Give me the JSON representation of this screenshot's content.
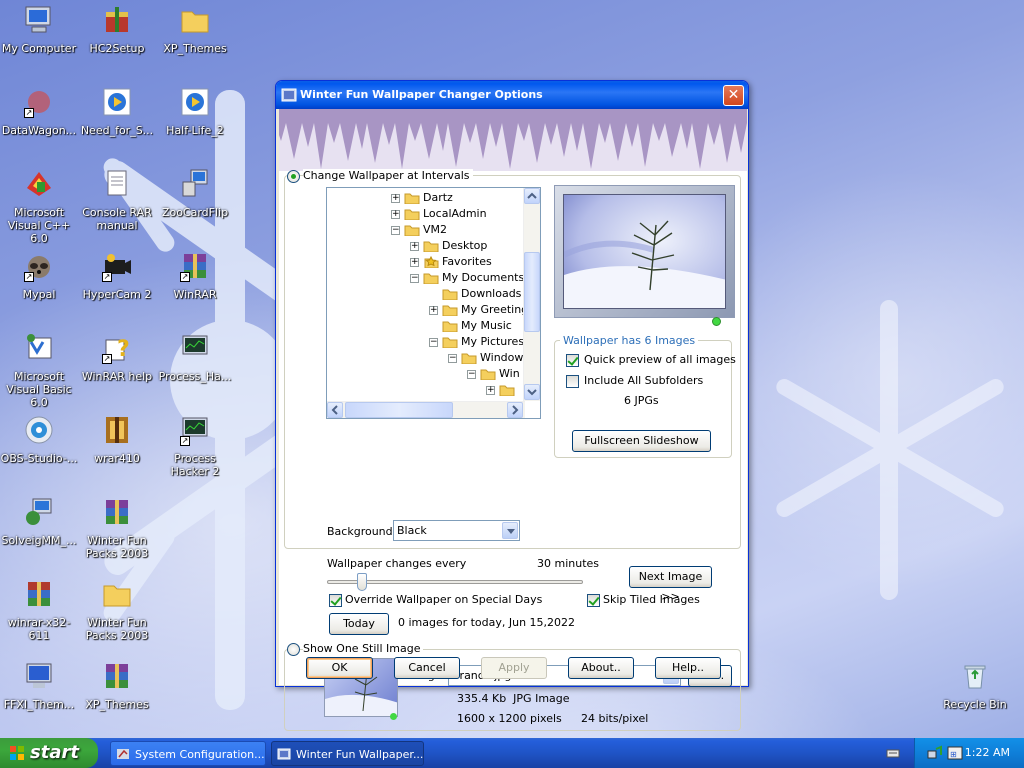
{
  "desktop": {
    "icons": [
      {
        "name": "my-computer",
        "label": "My Computer"
      },
      {
        "name": "hc2setup",
        "label": "HC2Setup"
      },
      {
        "name": "xp-themes-folder",
        "label": "XP_Themes"
      },
      {
        "name": "datawagon",
        "label": "DataWagon..."
      },
      {
        "name": "need-for-speed",
        "label": "Need_for_S..."
      },
      {
        "name": "half-life-2",
        "label": "Half-Life_2"
      },
      {
        "name": "visual-cpp",
        "label": "Microsoft Visual C++ 6.0"
      },
      {
        "name": "console-rar-manual",
        "label": "Console RAR manual"
      },
      {
        "name": "zoocardflip",
        "label": "ZooCardFlip"
      },
      {
        "name": "mypal",
        "label": "Mypal"
      },
      {
        "name": "hypercam",
        "label": "HyperCam 2"
      },
      {
        "name": "winrar",
        "label": "WinRAR"
      },
      {
        "name": "visual-basic",
        "label": "Microsoft Visual Basic 6.0"
      },
      {
        "name": "winrar-help",
        "label": "WinRAR help"
      },
      {
        "name": "process-hacker-1",
        "label": "Process_Ha..."
      },
      {
        "name": "obs-studio",
        "label": "OBS-Studio-..."
      },
      {
        "name": "wrar410",
        "label": "wrar410"
      },
      {
        "name": "process-hacker-2",
        "label": "Process Hacker 2"
      },
      {
        "name": "solveigmm",
        "label": "SolveigMM_..."
      },
      {
        "name": "winter-fun-packs-1",
        "label": "Winter Fun Packs 2003"
      },
      {
        "name": "winrar-x32",
        "label": "winrar-x32-611"
      },
      {
        "name": "winter-fun-packs-2",
        "label": "Winter Fun Packs 2003"
      },
      {
        "name": "ffxi-theme",
        "label": "FFXI_Them..."
      },
      {
        "name": "xp-themes-archive",
        "label": "XP_Themes"
      },
      {
        "name": "recycle-bin",
        "label": "Recycle Bin"
      }
    ]
  },
  "taskbar": {
    "start_label": "start",
    "tasks": [
      {
        "label": "System Configuration...",
        "active": false
      },
      {
        "label": "Winter Fun Wallpaper...",
        "active": true
      }
    ],
    "clock": "1:22 AM"
  },
  "dialog": {
    "title": "Winter Fun Wallpaper Changer Options",
    "close_label": "✕",
    "interval_mode_label": "Change Wallpaper at Intervals",
    "tree": [
      {
        "label": "Dartz",
        "expander": "+",
        "depth": 0
      },
      {
        "label": "LocalAdmin",
        "expander": "+",
        "depth": 0
      },
      {
        "label": "VM2",
        "expander": "−",
        "depth": 0
      },
      {
        "label": "Desktop",
        "expander": "+",
        "depth": 1
      },
      {
        "label": "Favorites",
        "expander": "+",
        "depth": 1
      },
      {
        "label": "My Documents",
        "expander": "−",
        "depth": 1
      },
      {
        "label": "Downloads",
        "expander": "",
        "depth": 2
      },
      {
        "label": "My Greetings",
        "expander": "+",
        "depth": 2
      },
      {
        "label": "My Music",
        "expander": "",
        "depth": 2
      },
      {
        "label": "My Pictures",
        "expander": "−",
        "depth": 2
      },
      {
        "label": "Windows",
        "expander": "−",
        "depth": 3
      },
      {
        "label": "Win",
        "expander": "−",
        "depth": 4
      },
      {
        "label": "",
        "expander": "+",
        "depth": 5
      }
    ],
    "background_label": "Background",
    "background_value": "Black",
    "wallpaper_count_label": "Wallpaper has 6 Images",
    "quick_preview_label": "Quick preview of all images",
    "include_subfolders_label": "Include All Subfolders",
    "jpg_count": "6 JPGs",
    "fullscreen_label": "Fullscreen Slideshow",
    "changes_every_label": "Wallpaper changes every",
    "interval_value": "30 minutes",
    "interval_fraction": 0.12,
    "next_image_label": "Next Image >>",
    "override_label": "Override Wallpaper on Special Days",
    "skip_tiled_label": "Skip Tiled Images",
    "today_label": "Today",
    "today_info": "0 images for today, Jun 15,2022",
    "still_mode_label": "Show One Still Image",
    "images_label": "Images:",
    "image_value": "Branch.jpg",
    "edit_label": "Edit..",
    "file_size": "335.4 Kb  JPG Image",
    "dimensions": "1600 x 1200 pixels",
    "bit_depth": "24 bits/pixel",
    "ok_label": "OK",
    "cancel_label": "Cancel",
    "apply_label": "Apply",
    "about_label": "About..",
    "help_label": "Help.."
  }
}
